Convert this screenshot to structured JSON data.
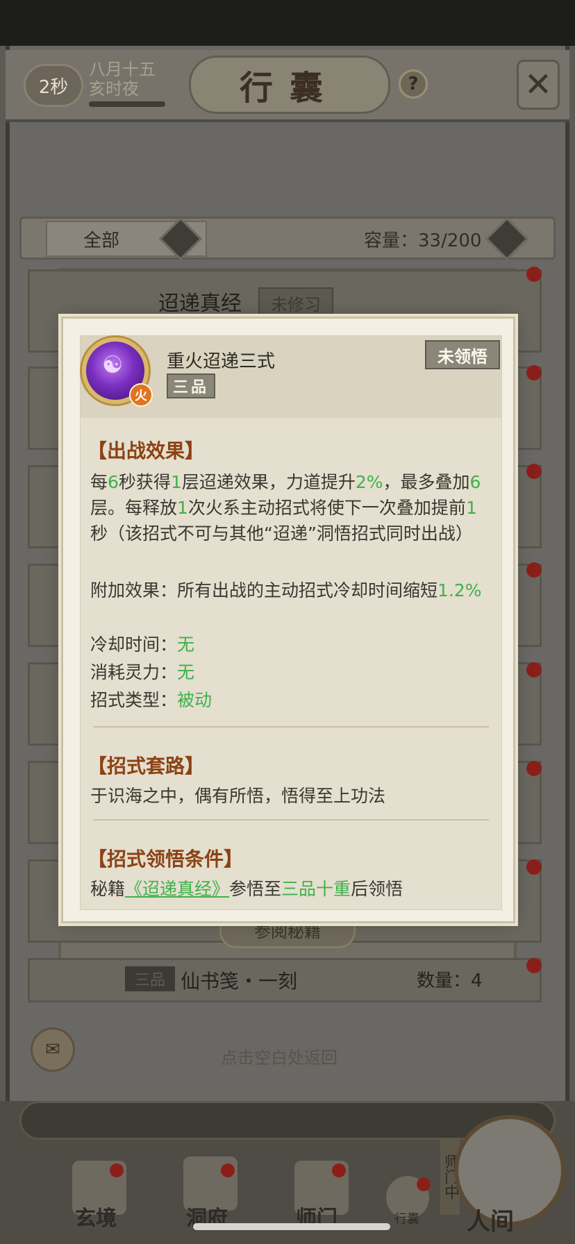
{
  "header": {
    "timer": "2秒",
    "date_line1": "八月十五",
    "date_line2": "亥时夜",
    "title": "行囊",
    "help": "?"
  },
  "filter": {
    "selected": "全部",
    "capacity_label": "容量：33/200"
  },
  "list": {
    "row1_title": "迢递真经",
    "row1_badge": "未修习",
    "read_button": "参阅秘籍",
    "bottom_grade": "三品",
    "bottom_name": "仙书笺・一刻",
    "bottom_qty": "数量：4"
  },
  "return_hint": "点击空白处返回",
  "nav": {
    "items": [
      {
        "label": "玄境"
      },
      {
        "label": "洞府"
      },
      {
        "label": "师门"
      },
      {
        "label": "行囊"
      }
    ],
    "shimen_vertical": "师门中",
    "world_label": "人间"
  },
  "popup": {
    "skill_name": "重火迢递三式",
    "grade": "三品",
    "status": "未领悟",
    "element": "火",
    "battle_effect_title": "【出战效果】",
    "battle_effect": {
      "p1": "每",
      "v1": "6",
      "p2": "秒获得",
      "v2": "1",
      "p3": "层迢递效果，力道提升",
      "v3": "2%",
      "p4": "，最多叠加",
      "v4": "6",
      "p5": "层。每释放",
      "v5": "1",
      "p6": "次火系主动招式将使下一次叠加提前",
      "v6": "1",
      "p7": "秒（该招式不可与其他“迢递”洞悟招式同时出战）"
    },
    "extra_effect_label": "附加效果：所有出战的主动招式冷却时间缩短",
    "extra_effect_value": "1.2%",
    "cooldown_label": "冷却时间：",
    "cooldown_value": "无",
    "cost_label": "消耗灵力：",
    "cost_value": "无",
    "type_label": "招式类型：",
    "type_value": "被动",
    "routine_title": "【招式套路】",
    "routine_text": "于识海之中，偶有所悟，悟得至上功法",
    "condition_title": "【招式领悟条件】",
    "condition_prefix": "秘籍",
    "condition_book": "《迢递真经》",
    "condition_mid": "参悟至",
    "condition_level": "三品十重",
    "condition_suffix": "后领悟"
  },
  "colors": {
    "accent_green": "#3fb14b",
    "section_brown": "#8c4214",
    "skill_purple": "#7a2fc0",
    "fire_orange": "#e0741f"
  }
}
